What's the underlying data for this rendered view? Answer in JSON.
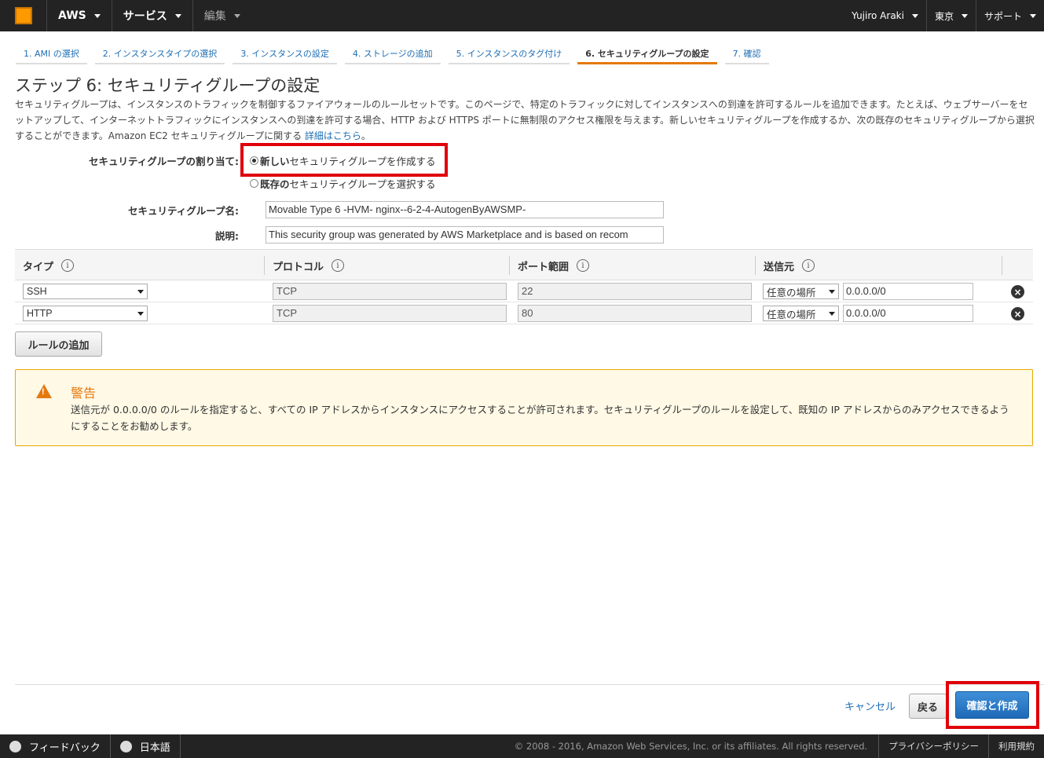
{
  "topnav": {
    "brand": "AWS",
    "services": "サービス",
    "edit": "編集",
    "user": "Yujiro Araki",
    "region": "東京",
    "support": "サポート"
  },
  "tabs": [
    {
      "label": "1. AMI の選択"
    },
    {
      "label": "2. インスタンスタイプの選択"
    },
    {
      "label": "3. インスタンスの設定"
    },
    {
      "label": "4. ストレージの追加"
    },
    {
      "label": "5. インスタンスのタグ付け"
    },
    {
      "label": "6. セキュリティグループの設定",
      "active": true
    },
    {
      "label": "7. 確認"
    }
  ],
  "page": {
    "title": "ステップ 6: セキュリティグループの設定",
    "description": "セキュリティグループは、インスタンスのトラフィックを制御するファイアウォールのルールセットです。このページで、特定のトラフィックに対してインスタンスへの到達を許可するルールを追加できます。たとえば、ウェブサーバーをセットアップして、インターネットトラフィックにインスタンスへの到達を許可する場合、HTTP および HTTPS ポートに無制限のアクセス権限を与えます。新しいセキュリティグループを作成するか、次の既存のセキュリティグループから選択することができます。Amazon EC2 セキュリティグループに関する ",
    "details_link": "詳細はこちら",
    "desc_end": "。"
  },
  "assign": {
    "label": "セキュリティグループの割り当て:",
    "option_new_bold": "新しい",
    "option_new_rest": "セキュリティグループを作成する",
    "option_existing_bold": "既存の",
    "option_existing_rest": "セキュリティグループを選択する",
    "selected": "new"
  },
  "form": {
    "name_label": "セキュリティグループ名:",
    "name_value": "Movable Type 6 -HVM- nginx--6-2-4-AutogenByAWSMP-",
    "desc_label": "説明:",
    "desc_value": "This security group was generated by AWS Marketplace and is based on recom"
  },
  "rules": {
    "headers": {
      "type": "タイプ",
      "protocol": "プロトコル",
      "port": "ポート範囲",
      "source": "送信元"
    },
    "info_glyph": "i",
    "remove_glyph": "×",
    "rows": [
      {
        "type": "SSH",
        "protocol": "TCP",
        "port": "22",
        "source_type": "任意の場所",
        "source_cidr": "0.0.0.0/0"
      },
      {
        "type": "HTTP",
        "protocol": "TCP",
        "port": "80",
        "source_type": "任意の場所",
        "source_cidr": "0.0.0.0/0"
      }
    ],
    "add_button": "ルールの追加"
  },
  "warning": {
    "mark": "!",
    "title": "警告",
    "text": "送信元が 0.0.0.0/0 のルールを指定すると、すべての IP アドレスからインスタンスにアクセスすることが許可されます。セキュリティグループのルールを設定して、既知の IP アドレスからのみアクセスできるようにすることをお勧めします。"
  },
  "actions": {
    "cancel": "キャンセル",
    "back": "戻る",
    "review": "確認と作成"
  },
  "footer": {
    "feedback": "フィードバック",
    "language": "日本語",
    "copyright": "© 2008 - 2016, Amazon Web Services, Inc. or its affiliates. All rights reserved.",
    "privacy": "プライバシーポリシー",
    "terms": "利用規約"
  },
  "colors": {
    "accent": "#e47911",
    "link": "#1e6eb4",
    "highlight": "#e0000a",
    "primary": "#1f69b6"
  }
}
